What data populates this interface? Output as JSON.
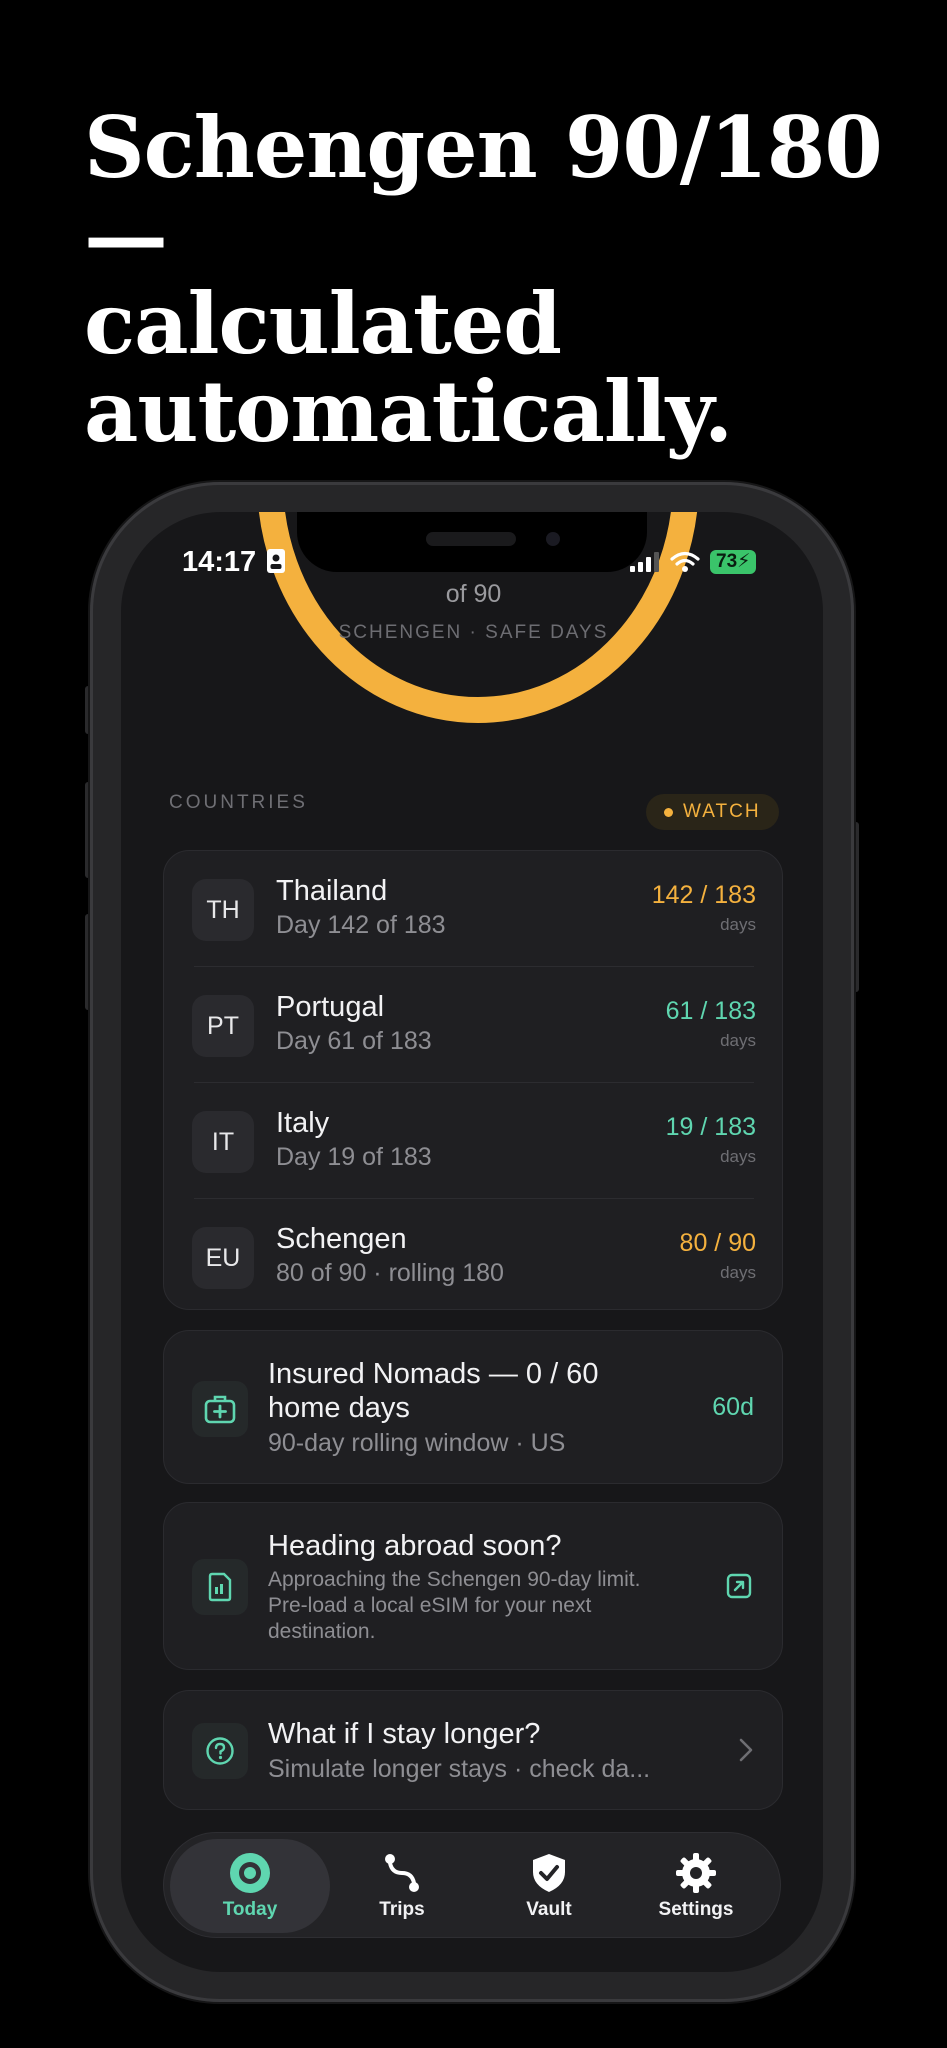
{
  "headline": {
    "line1": "Schengen 90/180 —",
    "line2": "calculated",
    "line3": "automatically."
  },
  "status_bar": {
    "time": "14:17",
    "battery": "73"
  },
  "arc": {
    "of_label": "of 90",
    "caption": "SCHENGEN · SAFE DAYS",
    "color": "#f4b13e"
  },
  "countries": {
    "label": "COUNTRIES",
    "badge": "WATCH",
    "rows": [
      {
        "code": "TH",
        "name": "Thailand",
        "detail": "Day 142 of 183",
        "count": "142 / 183",
        "unit": "days",
        "color": "#f4b13e"
      },
      {
        "code": "PT",
        "name": "Portugal",
        "detail": "Day 61 of 183",
        "count": "61 / 183",
        "unit": "days",
        "color": "#5fd6b0"
      },
      {
        "code": "IT",
        "name": "Italy",
        "detail": "Day 19 of 183",
        "count": "19 / 183",
        "unit": "days",
        "color": "#5fd6b0"
      },
      {
        "code": "EU",
        "name": "Schengen",
        "detail": "80 of 90 · rolling 180",
        "count": "80 / 90",
        "unit": "days",
        "color": "#f4b13e"
      }
    ]
  },
  "insurance": {
    "title_line1": "Insured Nomads — 0 / 60",
    "title_line2": "home days",
    "subtitle": "90-day rolling window · US",
    "value": "60d"
  },
  "esim": {
    "title": "Heading abroad soon?",
    "line1": "Approaching the Schengen 90-day limit.",
    "line2": "Pre-load a local eSIM for your next",
    "line3": "destination."
  },
  "what_if": {
    "title": "What if I stay longer?",
    "subtitle": "Simulate longer stays · check da..."
  },
  "tabs": [
    {
      "label": "Today",
      "icon": "target-icon"
    },
    {
      "label": "Trips",
      "icon": "route-icon"
    },
    {
      "label": "Vault",
      "icon": "shield-check-icon"
    },
    {
      "label": "Settings",
      "icon": "gear-icon"
    }
  ],
  "colors": {
    "accent_amber": "#f4b13e",
    "accent_green": "#5fd6b0"
  }
}
